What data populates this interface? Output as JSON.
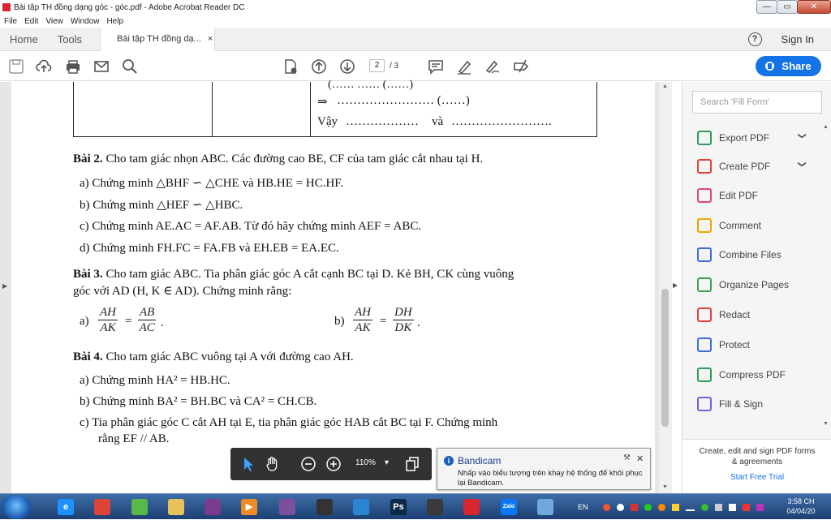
{
  "window": {
    "title": "Bài tập TH đồng dạng góc - góc.pdf - Adobe Acrobat Reader DC",
    "minimize": "—",
    "restore": "▭",
    "close": "✕"
  },
  "menu": [
    "File",
    "Edit",
    "View",
    "Window",
    "Help"
  ],
  "tabs": {
    "home": "Home",
    "tools": "Tools",
    "document": "Bài tập TH đồng dạ...",
    "close": "×",
    "help": "?",
    "signin": "Sign In"
  },
  "toolbar": {
    "page_current": "2",
    "page_total": "/ 3",
    "share": "Share"
  },
  "document": {
    "table": {
      "row1": "(……    ……  (……)",
      "row2_arrow": "⇒",
      "row2": "……………………  (……)",
      "row3_label": "Vậy",
      "row3_fill1": "………………",
      "row3_and": "và",
      "row3_fill2": "……………………."
    },
    "bai2": {
      "heading": "Bài 2.",
      "text": "Cho tam giác nhọn ABC. Các đường cao BE, CF của tam giác cắt nhau tại H.",
      "items": [
        "a)  Chứng minh △BHF ∽ △CHE và HB.HE = HC.HF.",
        "b)  Chứng minh △HEF ∽ △HBC.",
        "c)  Chứng minh AE.AC = AF.AB. Từ đó hãy chứng minh AEF = ABC.",
        "d)  Chứng minh FH.FC = FA.FB và EH.EB = EA.EC."
      ]
    },
    "bai3": {
      "heading": "Bài 3.",
      "text1": "Cho tam giác ABC. Tia phân giác góc A cắt cạnh BC tại D. Kẻ BH, CK cùng vuông",
      "text2": "góc với AD (H, K ∈ AD). Chứng minh rằng:",
      "a_label": "a)",
      "a_n1": "AH",
      "a_d1": "AK",
      "a_eq": "=",
      "a_n2": "AB",
      "a_d2": "AC",
      "a_dot": ".",
      "b_label": "b)",
      "b_n1": "AH",
      "b_d1": "AK",
      "b_eq": "=",
      "b_n2": "DH",
      "b_d2": "DK",
      "b_dot": "."
    },
    "bai4": {
      "heading": "Bài 4.",
      "text": "Cho tam giác ABC vuông tại A với đường cao AH.",
      "items": [
        "a)  Chứng minh HA² = HB.HC.",
        "b)  Chứng minh BA² = BH.BC và CA² = CH.CB.",
        "c)  Tia phân giác góc C cắt AH tại E, tia phân giác góc HAB cắt BC tại F. Chứng minh"
      ],
      "c_cont": "rằng EF // AB."
    }
  },
  "right_panel": {
    "search_placeholder": "Search 'Fill Form'",
    "tools": [
      {
        "label": "Export PDF",
        "color": "#2d9e5a"
      },
      {
        "label": "Create PDF",
        "color": "#e0413d"
      },
      {
        "label": "Edit PDF",
        "color": "#e0457b"
      },
      {
        "label": "Comment",
        "color": "#f0a400"
      },
      {
        "label": "Combine Files",
        "color": "#3c6fd8"
      },
      {
        "label": "Organize Pages",
        "color": "#3fa34d"
      },
      {
        "label": "Redact",
        "color": "#e0413d"
      },
      {
        "label": "Protect",
        "color": "#3c6fd8"
      },
      {
        "label": "Compress PDF",
        "color": "#2d9e5a"
      },
      {
        "label": "Fill & Sign",
        "color": "#7b5bd6"
      }
    ],
    "chevron": "❯",
    "promo_title": "Create, edit and sign PDF forms & agreements",
    "promo_link": "Start Free Trial"
  },
  "floatbar": {
    "zoom": "110%",
    "caret": "▾"
  },
  "notification": {
    "title": "Bandicam",
    "body": "Nhấp vào biểu tượng trên khay hệ thống để khôi phục lại Bandicam.",
    "info": "i",
    "close": "✕",
    "pin": "🔧"
  },
  "taskbar": {
    "lang": "EN",
    "time": "3:58 CH",
    "date": "04/04/20",
    "apps": [
      {
        "name": "internet-explorer",
        "glyph": "e",
        "color": "#1e90ff"
      },
      {
        "name": "chrome",
        "glyph": "",
        "color": "#db4437"
      },
      {
        "name": "app-green",
        "glyph": "",
        "color": "#58b947"
      },
      {
        "name": "file-explorer",
        "glyph": "",
        "color": "#e8c25a"
      },
      {
        "name": "winrar",
        "glyph": "",
        "color": "#7a3b8f"
      },
      {
        "name": "media-player",
        "glyph": "▶",
        "color": "#f08a24"
      },
      {
        "name": "viber",
        "glyph": "",
        "color": "#7b519d"
      },
      {
        "name": "obs",
        "glyph": "",
        "color": "#333333"
      },
      {
        "name": "app-blue-circle",
        "glyph": "",
        "color": "#2a84d2"
      },
      {
        "name": "photoshop",
        "glyph": "Ps",
        "color": "#0b2a4a"
      },
      {
        "name": "app-dark",
        "glyph": "",
        "color": "#3a3a3a"
      },
      {
        "name": "acrobat",
        "glyph": "",
        "color": "#d7262e"
      },
      {
        "name": "zalo",
        "glyph": "Zalo",
        "color": "#0a79f7"
      },
      {
        "name": "picture-viewer",
        "glyph": "",
        "color": "#6fa8dc"
      }
    ]
  }
}
